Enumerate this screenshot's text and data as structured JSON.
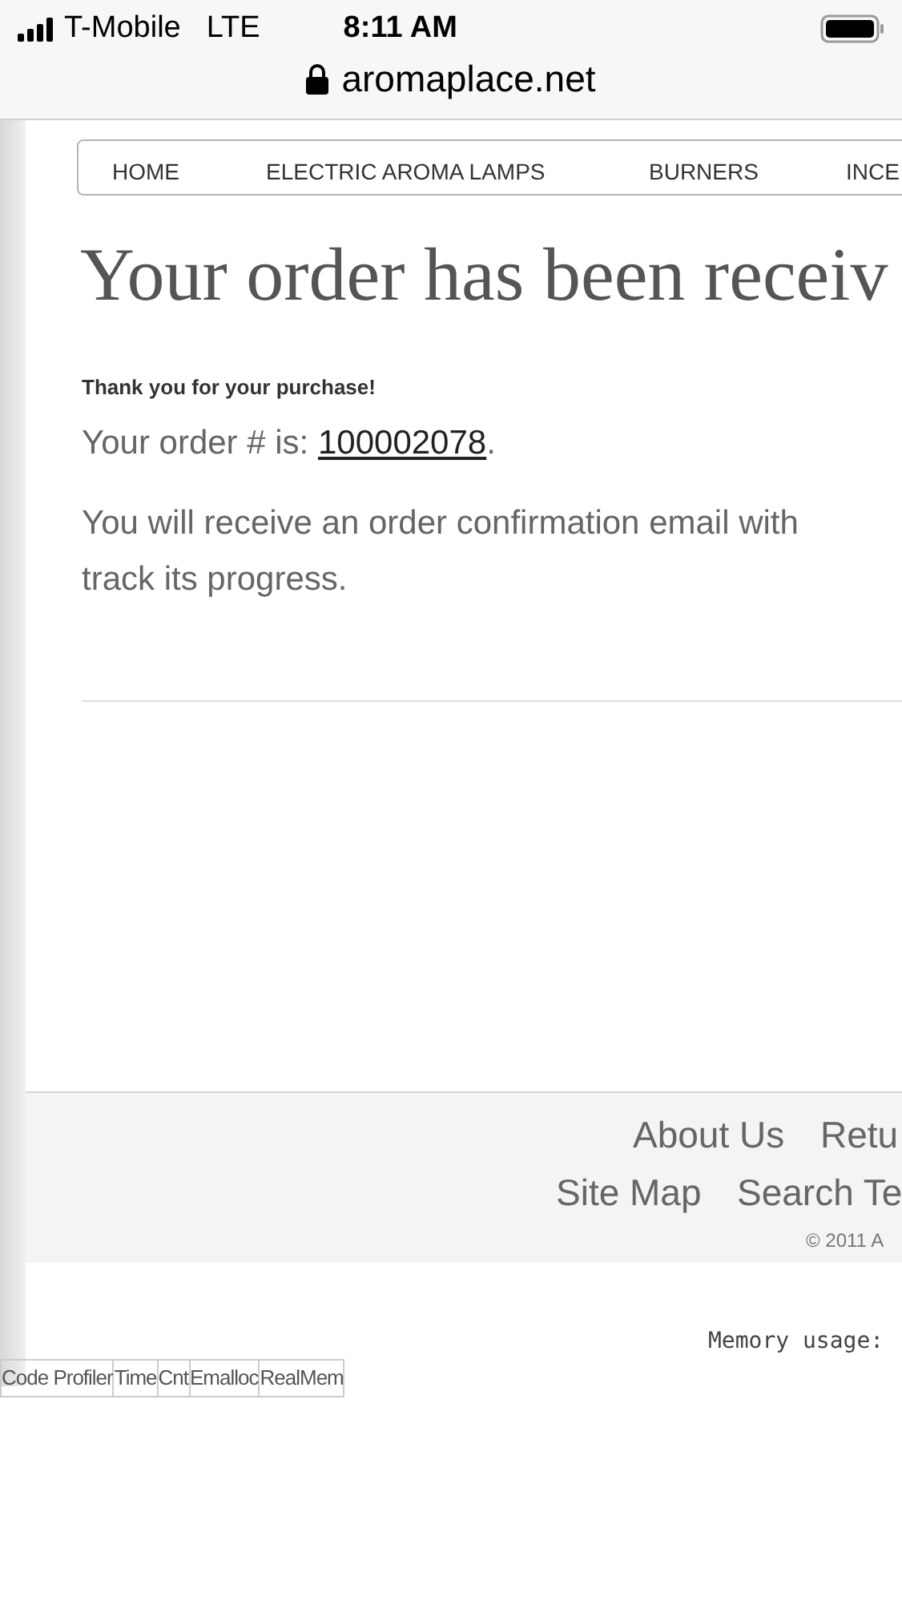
{
  "status_bar": {
    "carrier": "T-Mobile",
    "network": "LTE",
    "time": "8:11 AM"
  },
  "address_bar": {
    "url": "aromaplace.net"
  },
  "nav": [
    {
      "label": "HOME"
    },
    {
      "label": "ELECTRIC AROMA LAMPS"
    },
    {
      "label": "BURNERS"
    },
    {
      "label": "INCE"
    }
  ],
  "heading": "Your order has been receiv",
  "thanks": "Thank you for your purchase!",
  "order_prefix": "Your order # is: ",
  "order_number": "100002078",
  "order_suffix": ".",
  "confirmation_lines": [
    "You will receive an order confirmation email with",
    "track its progress."
  ],
  "footer": {
    "rows": [
      [
        "About Us",
        "Retu"
      ],
      [
        "Site Map",
        "Search Te"
      ]
    ],
    "copyright": "© 2011 A"
  },
  "memory_usage": "Memory usage:",
  "profiler_columns": [
    "Code Profiler",
    "Time",
    "Cnt",
    "Emalloc",
    "RealMem"
  ]
}
